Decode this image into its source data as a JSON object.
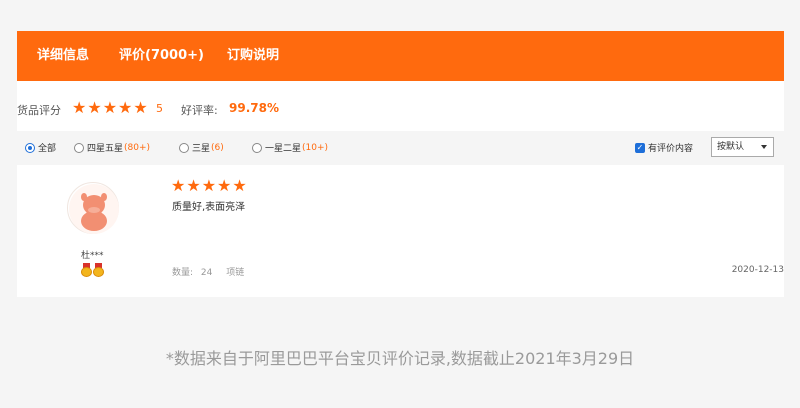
{
  "tabs": [
    {
      "label": "详细信息"
    },
    {
      "label": "评价(7000+)"
    },
    {
      "label": "订购说明"
    }
  ],
  "rating": {
    "label": "货品评分",
    "stars": 5,
    "score": "5",
    "good_rate_label": "好评率:",
    "good_rate_value": "99.78%"
  },
  "filters": {
    "options": [
      {
        "label": "全部",
        "count": "",
        "selected": true
      },
      {
        "label": "四星五星",
        "count": "(80+)",
        "selected": false
      },
      {
        "label": "三星",
        "count": "(6)",
        "selected": false
      },
      {
        "label": "一星二星",
        "count": "(10+)",
        "selected": false
      }
    ],
    "has_content_label": "有评价内容",
    "has_content_checked": true,
    "sort_value": "按默认"
  },
  "review": {
    "user": "杜***",
    "stars": 5,
    "text": "质量好,表面亮泽",
    "quantity_label": "数量:",
    "quantity_value": "24",
    "variant": "项链",
    "date": "2020-12-13"
  },
  "footer_note": "*数据来自于阿里巴巴平台宝贝评价记录,数据截止2021年3月29日",
  "colors": {
    "accent": "#ff6a0e",
    "link_blue": "#1e6fd9"
  }
}
